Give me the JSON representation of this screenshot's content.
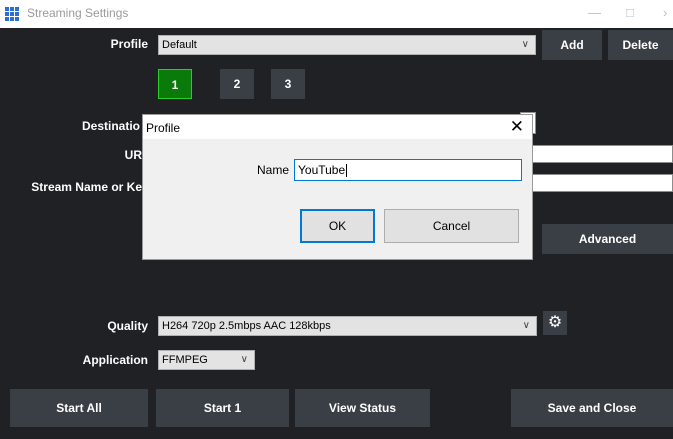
{
  "window": {
    "title": "Streaming Settings",
    "minimize_icon": "minimize-icon",
    "maximize_icon": "maximize-icon",
    "close_icon": "close-icon"
  },
  "profile": {
    "label": "Profile",
    "value": "Default",
    "add_label": "Add",
    "delete_label": "Delete"
  },
  "tabs": [
    {
      "label": "1",
      "active": true
    },
    {
      "label": "2",
      "active": false
    },
    {
      "label": "3",
      "active": false
    }
  ],
  "fields": {
    "destination_label": "Destinatio",
    "url_label": "UR",
    "stream_name_label": "Stream Name or Ke",
    "advanced_label": "Advanced"
  },
  "quality": {
    "label": "Quality",
    "value": "H264 720p 2.5mbps AAC 128kbps",
    "settings_icon": "gear-icon"
  },
  "application": {
    "label": "Application",
    "value": "FFMPEG"
  },
  "bottom": {
    "start_all": "Start All",
    "start_1": "Start 1",
    "view_status": "View Status",
    "save_close": "Save and Close"
  },
  "dialog": {
    "title": "Profile",
    "name_label": "Name",
    "name_value": "YouTube",
    "ok_label": "OK",
    "cancel_label": "Cancel",
    "close_icon": "close-icon"
  },
  "colors": {
    "background": "#1f2125",
    "button": "#3a3e45",
    "active_tab": "#0a7a0a",
    "active_tab_border": "#2dcc2d",
    "focus": "#0078d7"
  }
}
